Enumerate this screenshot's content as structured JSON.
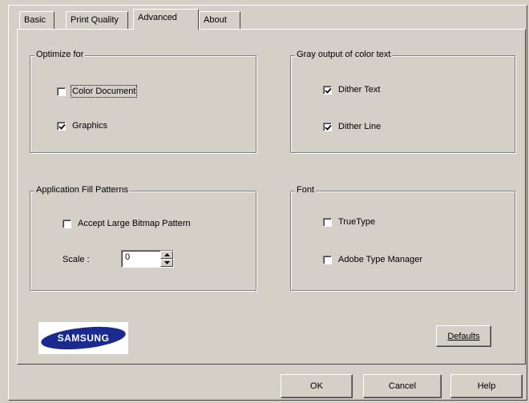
{
  "tabs": [
    "Basic",
    "Print Quality",
    "Advanced",
    "About"
  ],
  "optimize": {
    "title": "Optimize for",
    "color_document": "Color Document",
    "graphics": "Graphics"
  },
  "gray": {
    "title": "Gray output of color text",
    "dither_text": "Dither Text",
    "dither_line": "Dither Line"
  },
  "fill": {
    "title": "Application Fill Patterns",
    "accept_large_bitmap": "Accept Large Bitmap Pattern",
    "scale_label": "Scale :",
    "scale_value": "0"
  },
  "font": {
    "title": "Font",
    "truetype": "TrueType",
    "atm": "Adobe Type Manager"
  },
  "logo_text": "SAMSUNG",
  "buttons": {
    "defaults": "Defaults",
    "ok": "OK",
    "cancel": "Cancel",
    "help": "Help"
  },
  "colors": {
    "face": "#d4d0c8",
    "logo_blue": "#1b2a8f"
  },
  "icons": [
    "check-icon",
    "spin-up-arrow-icon",
    "spin-down-arrow-icon"
  ]
}
